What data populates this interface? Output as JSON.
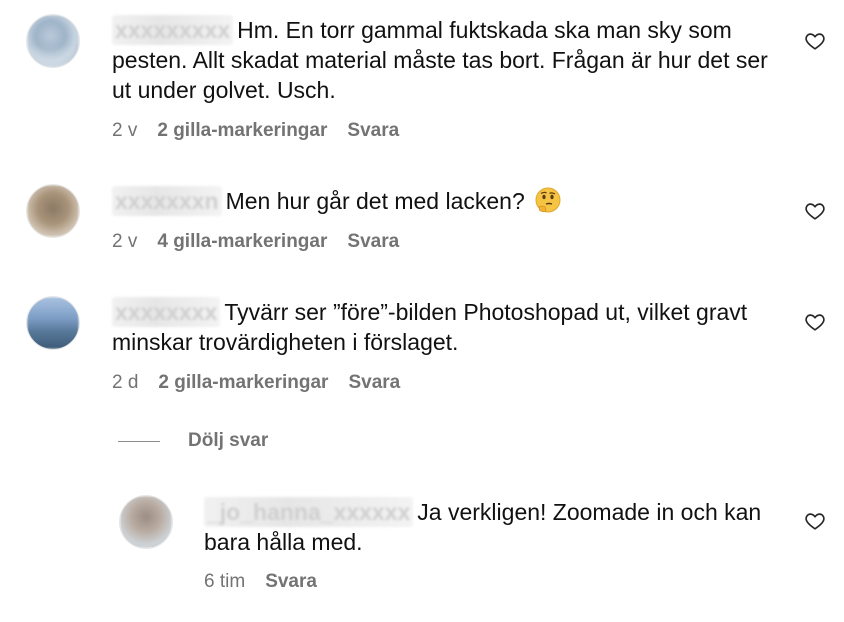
{
  "comments": [
    {
      "username": "xxxxxxxxx",
      "text": "Hm. En torr gammal fuktskada ska man sky som pesten. Allt skadat material måste tas bort. Frågan är hur det ser ut under golvet. Usch.",
      "age": "2 v",
      "likes": "2 gilla-markeringar",
      "reply": "Svara"
    },
    {
      "username": "xxxxxxxn",
      "text": "Men hur går det med lacken?",
      "age": "2 v",
      "likes": "4 gilla-markeringar",
      "reply": "Svara",
      "emoji": "thinking-face-emoji"
    },
    {
      "username": "xxxxxxxx",
      "text": "Tyvärr ser ”före”-bilden Photoshopad ut, vilket gravt minskar trovärdigheten i förslaget.",
      "age": "2 d",
      "likes": "2 gilla-markeringar",
      "reply": "Svara"
    }
  ],
  "hide_replies_label": "Dölj svar",
  "reply_comment": {
    "username": "_jo_hanna_xxxxxx",
    "text": "Ja verkligen! Zoomade in och kan bara hålla med.",
    "age": "6 tim",
    "reply": "Svara"
  },
  "icons": {
    "like": "heart-outline-icon"
  },
  "colors": {
    "text": "#111111",
    "muted": "#737373",
    "background": "#ffffff"
  }
}
